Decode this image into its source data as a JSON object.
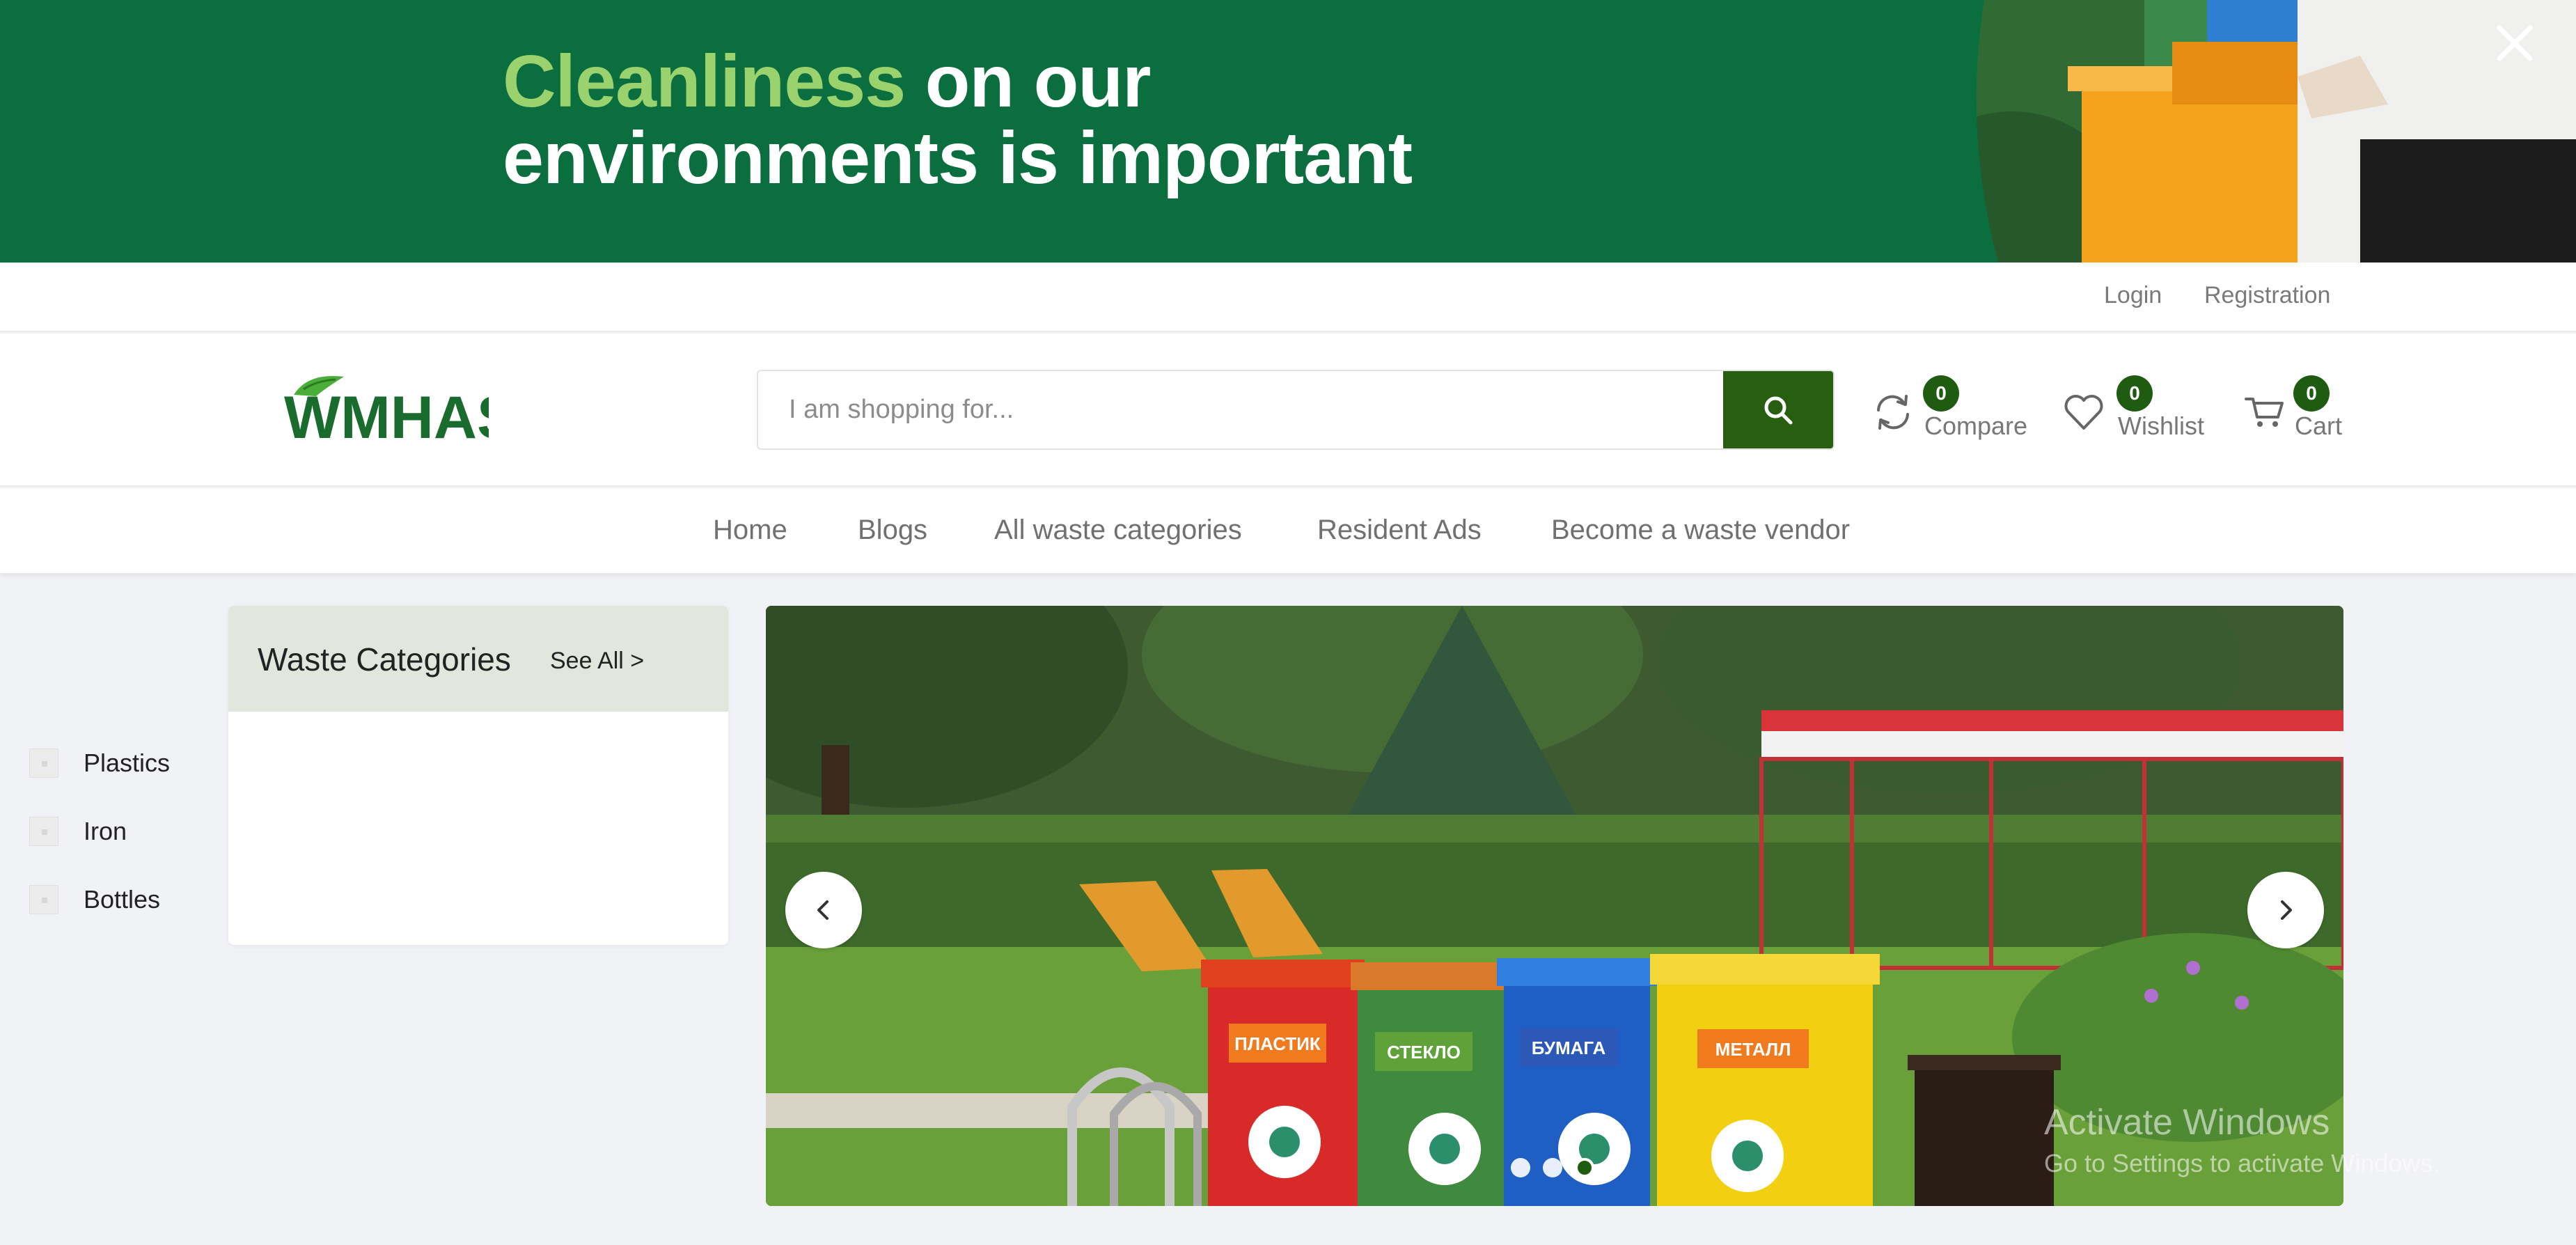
{
  "banner": {
    "headline_highlight": "Cleanliness",
    "headline_rest_line1": " on our",
    "headline_line2": "environments is important"
  },
  "topbar": {
    "login": "Login",
    "registration": "Registration"
  },
  "header": {
    "logo_text": "WMHAS",
    "search_placeholder": "I am shopping for...",
    "compare": {
      "label": "Compare",
      "count": "0"
    },
    "wishlist": {
      "label": "Wishlist",
      "count": "0"
    },
    "cart": {
      "label": "Cart",
      "count": "0"
    }
  },
  "nav": {
    "items": [
      "Home",
      "Blogs",
      "All waste categories",
      "Resident Ads",
      "Become a waste vendor"
    ]
  },
  "categories": {
    "title": "Waste Categories",
    "see_all": "See All >",
    "items": [
      "Plastics",
      "Iron",
      "Bottles"
    ]
  },
  "slider": {
    "bin_labels": [
      "ПЛАСТИК",
      "СТЕКЛО",
      "БУМАГА",
      "МЕТАЛЛ"
    ],
    "slide_count": 3,
    "active_slide": 3
  },
  "watermark": {
    "title": "Activate Windows",
    "subtitle": "Go to Settings to activate Windows."
  },
  "colors": {
    "banner_bg": "#0a6e3f",
    "highlight": "#9ad26e",
    "brand_dark": "#275e10",
    "badge": "#1f5c12"
  }
}
